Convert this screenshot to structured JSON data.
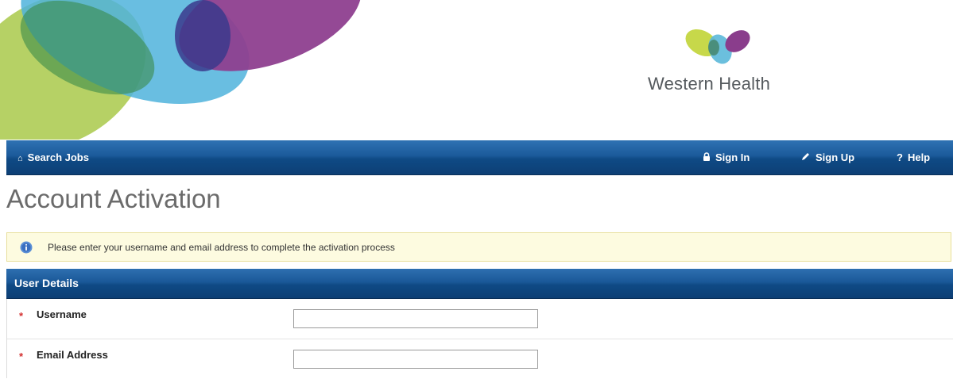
{
  "brand": {
    "name": "Western Health",
    "colors": {
      "green": "#a9c94a",
      "teal": "#5bb8d9",
      "purple": "#8a3d8c",
      "navy": "#1b5a9a"
    }
  },
  "nav": {
    "search_jobs": {
      "label": "Search Jobs",
      "icon": "home-icon"
    },
    "sign_in": {
      "label": "Sign In",
      "icon": "lock-icon"
    },
    "sign_up": {
      "label": "Sign Up",
      "icon": "pencil-icon"
    },
    "help": {
      "label": "Help",
      "icon": "question-icon"
    }
  },
  "page": {
    "title": "Account Activation"
  },
  "info": {
    "text": "Please enter your username and email address to complete the activation process",
    "icon": "info-icon"
  },
  "panel": {
    "title": "User Details",
    "fields": [
      {
        "label": "Username",
        "required_marker": "*",
        "value": ""
      },
      {
        "label": "Email Address",
        "required_marker": "*",
        "value": ""
      }
    ]
  }
}
